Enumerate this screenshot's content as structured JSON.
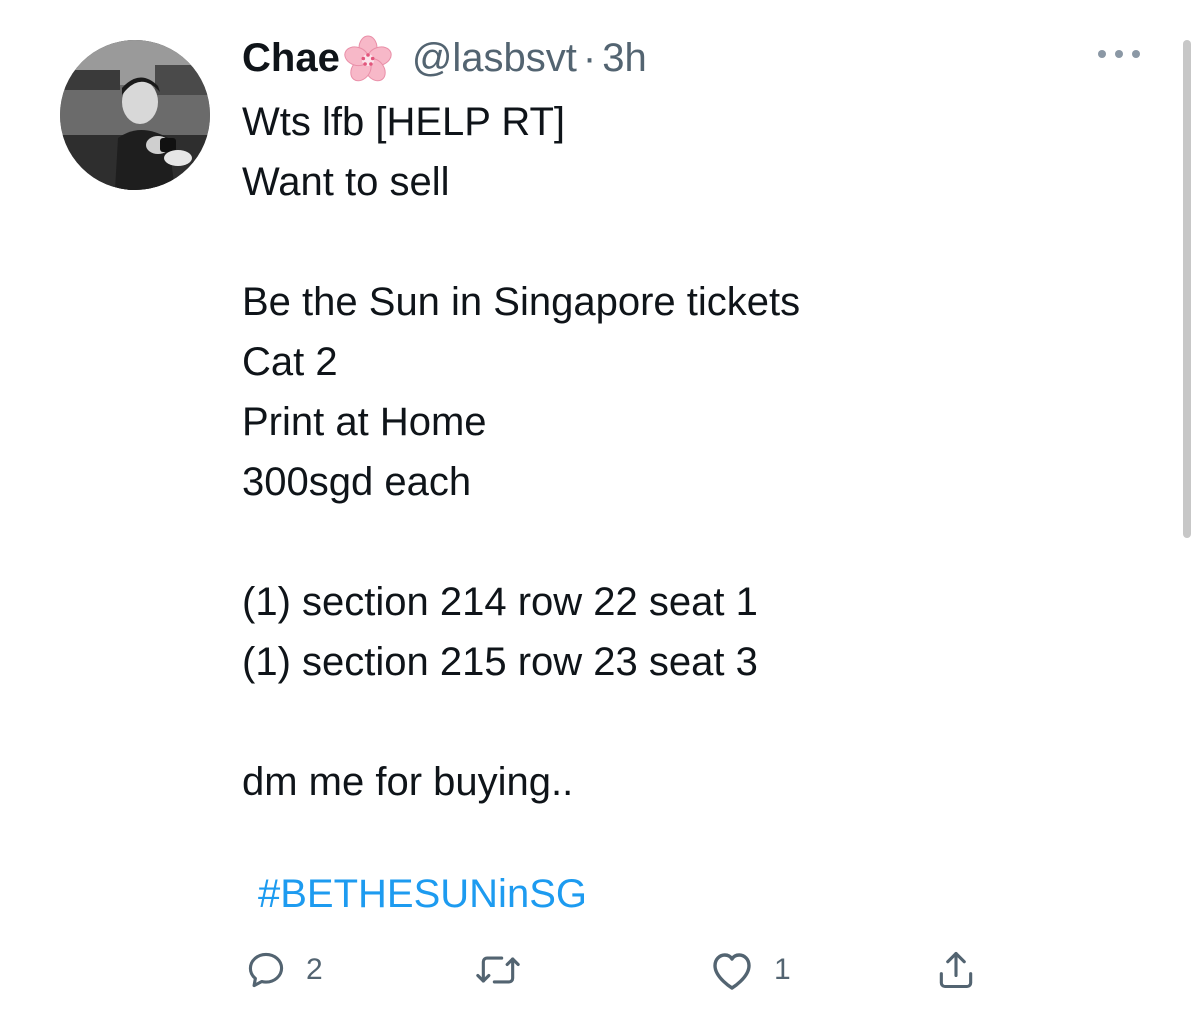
{
  "user": {
    "display_name": "Chae",
    "emoji": "cherry-blossom",
    "handle": "@lasbsvt",
    "separator": "·",
    "time": "3h"
  },
  "tweet": {
    "lines": [
      "Wts lfb [HELP RT]",
      "Want to sell",
      "",
      "Be the Sun in Singapore tickets",
      "Cat 2",
      "Print at Home",
      "300sgd each",
      "",
      "(1) section 214 row 22 seat 1",
      "(1) section 215 row 23 seat 3",
      "",
      "dm me for buying.."
    ],
    "hashtag": "#BETHESUNinSG"
  },
  "actions": {
    "reply_count": "2",
    "retweet_count": "",
    "like_count": "1"
  },
  "colors": {
    "text": "#0f1419",
    "secondary": "#536471",
    "link": "#1d9bf0",
    "blossom": "#f7b8c8"
  },
  "icons": {
    "more": "more-horizontal-icon",
    "reply": "reply-icon",
    "retweet": "retweet-icon",
    "like": "heart-icon",
    "share": "share-icon"
  }
}
